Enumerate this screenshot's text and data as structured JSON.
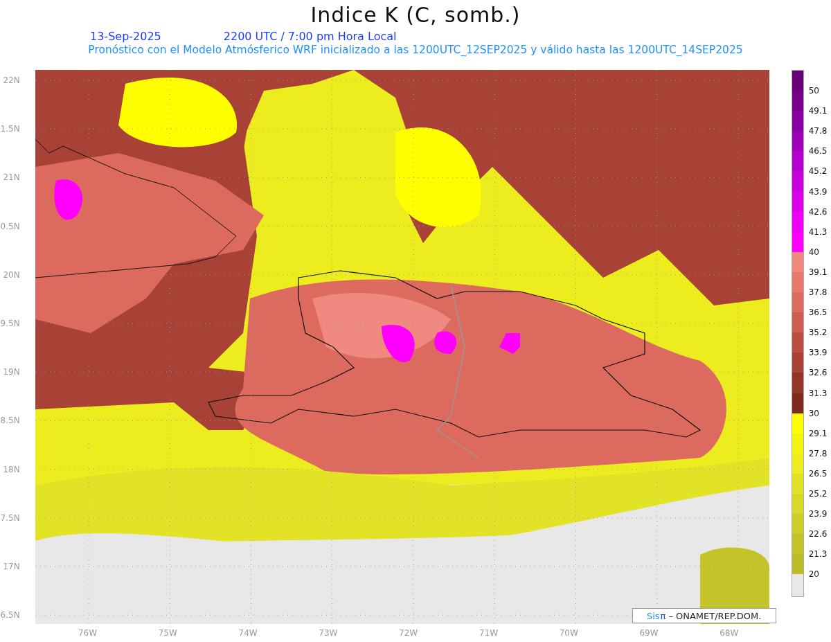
{
  "title": "Indice K (C, somb.)",
  "date": "13-Sep-2025",
  "time": "2200 UTC / 7:00 pm Hora Local",
  "subtitle": "Pronóstico con el Modelo Atmósferico WRF inicializado a las 1200UTC_12SEP2025 y válido hasta las  1200UTC_14SEP2025",
  "y_axis": {
    "ticks": [
      "22N",
      "1.5N",
      "21N",
      "0.5N",
      "20N",
      "9.5N",
      "19N",
      "8.5N",
      "18N",
      "7.5N",
      "17N",
      "6.5N"
    ]
  },
  "x_axis": {
    "ticks": [
      "76W",
      "75W",
      "74W",
      "73W",
      "72W",
      "71W",
      "70W",
      "69W",
      "68W"
    ]
  },
  "credit": {
    "brand": "Sis",
    "symbol": "π",
    "text": "–  ONAMET/REP.DOM."
  },
  "colorbar": [
    {
      "label": "50",
      "color": "#660077"
    },
    {
      "label": "49.1",
      "color": "#770088"
    },
    {
      "label": "47.8",
      "color": "#8800a0"
    },
    {
      "label": "46.5",
      "color": "#9e00b8"
    },
    {
      "label": "45.2",
      "color": "#b400cc"
    },
    {
      "label": "43.9",
      "color": "#c800dd"
    },
    {
      "label": "42.6",
      "color": "#dc00ea"
    },
    {
      "label": "41.3",
      "color": "#ee00f6"
    },
    {
      "label": "40",
      "color": "#ff00ff"
    },
    {
      "label": "39.1",
      "color": "#f08a80"
    },
    {
      "label": "37.8",
      "color": "#e8786c"
    },
    {
      "label": "36.5",
      "color": "#dc6a5e"
    },
    {
      "label": "35.2",
      "color": "#ce5c50"
    },
    {
      "label": "33.9",
      "color": "#bc4e42"
    },
    {
      "label": "32.6",
      "color": "#a84236"
    },
    {
      "label": "31.3",
      "color": "#94362a"
    },
    {
      "label": "30",
      "color": "#7e2c1e"
    },
    {
      "label": "29.1",
      "color": "#ffff00"
    },
    {
      "label": "27.8",
      "color": "#f5f512"
    },
    {
      "label": "26.5",
      "color": "#ecec1e"
    },
    {
      "label": "25.2",
      "color": "#e2e226"
    },
    {
      "label": "23.9",
      "color": "#d8d82a"
    },
    {
      "label": "22.6",
      "color": "#cece2a"
    },
    {
      "label": "21.3",
      "color": "#c4c42a"
    },
    {
      "label": "20",
      "color": "#bcbc26"
    }
  ]
}
